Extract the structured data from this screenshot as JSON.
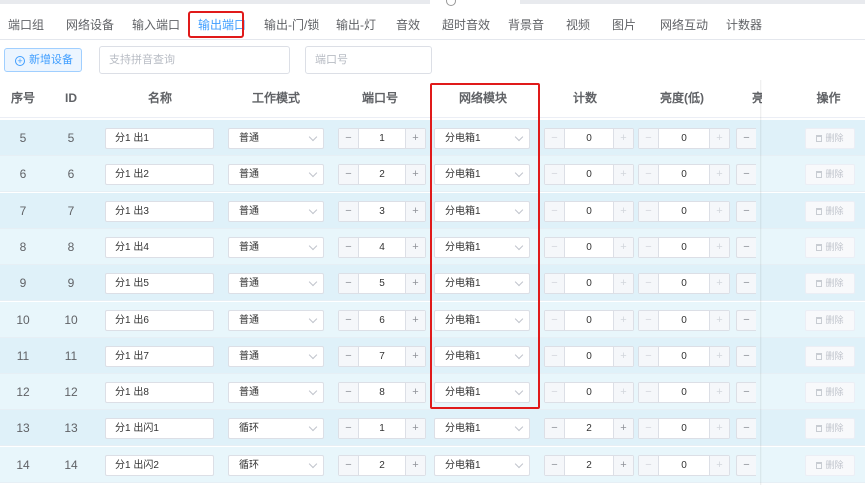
{
  "tabs": [
    {
      "label": "端口组"
    },
    {
      "label": "网络设备"
    },
    {
      "label": "输入端口"
    },
    {
      "label": "输出端口"
    },
    {
      "label": "输出-门/锁"
    },
    {
      "label": "输出-灯"
    },
    {
      "label": "音效"
    },
    {
      "label": "超时音效"
    },
    {
      "label": "背景音"
    },
    {
      "label": "视频"
    },
    {
      "label": "图片"
    },
    {
      "label": "网络互动"
    },
    {
      "label": "计数器"
    }
  ],
  "active_tab": "输出端口",
  "toolbar": {
    "add_label": "新增设备",
    "add_icon": "plus-circle-icon",
    "search_placeholder": "支持拼音查询",
    "port_placeholder": "端口号"
  },
  "table": {
    "headers": {
      "index": "序号",
      "id": "ID",
      "name": "名称",
      "mode": "工作模式",
      "port": "端口号",
      "module": "网络模块",
      "count": "计数",
      "brightness": "亮度(低)",
      "cut": "亮",
      "action": "操作"
    },
    "delete_label": "删除",
    "rows": [
      {
        "index": "5",
        "id": "5",
        "name": "分1 出1",
        "mode": "普通",
        "port": "1",
        "module": "分电箱1",
        "count": "0",
        "brightness": "0"
      },
      {
        "index": "6",
        "id": "6",
        "name": "分1 出2",
        "mode": "普通",
        "port": "2",
        "module": "分电箱1",
        "count": "0",
        "brightness": "0"
      },
      {
        "index": "7",
        "id": "7",
        "name": "分1 出3",
        "mode": "普通",
        "port": "3",
        "module": "分电箱1",
        "count": "0",
        "brightness": "0"
      },
      {
        "index": "8",
        "id": "8",
        "name": "分1 出4",
        "mode": "普通",
        "port": "4",
        "module": "分电箱1",
        "count": "0",
        "brightness": "0"
      },
      {
        "index": "9",
        "id": "9",
        "name": "分1 出5",
        "mode": "普通",
        "port": "5",
        "module": "分电箱1",
        "count": "0",
        "brightness": "0"
      },
      {
        "index": "10",
        "id": "10",
        "name": "分1 出6",
        "mode": "普通",
        "port": "6",
        "module": "分电箱1",
        "count": "0",
        "brightness": "0"
      },
      {
        "index": "11",
        "id": "11",
        "name": "分1 出7",
        "mode": "普通",
        "port": "7",
        "module": "分电箱1",
        "count": "0",
        "brightness": "0"
      },
      {
        "index": "12",
        "id": "12",
        "name": "分1 出8",
        "mode": "普通",
        "port": "8",
        "module": "分电箱1",
        "count": "0",
        "brightness": "0"
      },
      {
        "index": "13",
        "id": "13",
        "name": "分1 出闪1",
        "mode": "循环",
        "port": "1",
        "module": "分电箱1",
        "count": "2",
        "brightness": "0"
      },
      {
        "index": "14",
        "id": "14",
        "name": "分1 出闪2",
        "mode": "循环",
        "port": "2",
        "module": "分电箱1",
        "count": "2",
        "brightness": "0"
      }
    ]
  },
  "colors": {
    "accent": "#409eff",
    "highlight": "#e01a1a",
    "row_bg": "#dff1f9"
  }
}
